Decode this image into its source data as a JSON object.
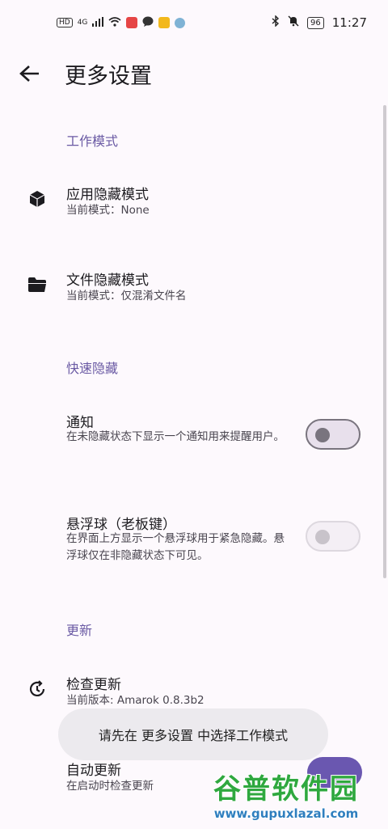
{
  "status_bar": {
    "network_label": "HD",
    "signal_label": "4G",
    "battery": "96",
    "time": "11:27",
    "colors": {
      "red_app": "#e64545",
      "yellow_app": "#f2b81c",
      "blue_app": "#7fb3d5"
    }
  },
  "app_bar": {
    "title": "更多设置",
    "back_icon": "arrow-left-icon"
  },
  "sections": {
    "work_mode": {
      "header": "工作模式"
    },
    "quick_hide": {
      "header": "快速隐藏"
    },
    "update": {
      "header": "更新"
    }
  },
  "prefs": {
    "app_hide": {
      "title": "应用隐藏模式",
      "summary": "当前模式：None",
      "icon": "cube-icon"
    },
    "file_hide": {
      "title": "文件隐藏模式",
      "summary": "当前模式：仅混淆文件名",
      "icon": "folder-icon"
    },
    "notification": {
      "title": "通知",
      "summary": "在未隐藏状态下显示一个通知用来提醒用户。",
      "checked": false,
      "enabled": true
    },
    "floating_ball": {
      "title": "悬浮球（老板键）",
      "summary": "在界面上方显示一个悬浮球用于紧急隐藏。悬浮球仅在非隐藏状态下可见。",
      "checked": false,
      "enabled": false
    },
    "check_update": {
      "title": "检查更新",
      "summary": "当前版本: Amarok 0.8.3b2",
      "icon": "update-history-icon"
    },
    "auto_update": {
      "title": "自动更新",
      "summary": "在启动时检查更新",
      "checked": true
    }
  },
  "toast": {
    "message": "请先在 更多设置 中选择工作模式"
  },
  "watermark": {
    "title": "谷普软件园",
    "url": "www.gupuxlazal.com"
  },
  "colors": {
    "accent": "#6a5aa4",
    "switch_on": "#6a57b0",
    "background": "#fdf9fd"
  }
}
